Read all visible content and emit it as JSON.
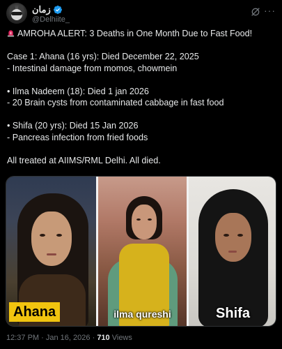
{
  "author": {
    "display_name": "زمان",
    "handle": "@Delhiite_",
    "verified": true
  },
  "post": {
    "lines": [
      "AMROHA ALERT: 3 Deaths in One Month Due to Fast Food!",
      "",
      "Case 1: Ahana (16 yrs): Died December 22, 2025",
      "- Intestinal damage from momos, chowmein",
      "",
      "• Ilma Nadeem (18): Died 1 jan 2026",
      "- 20 Brain cysts from contaminated cabbage in fast food",
      "",
      "• Shifa (20 yrs): Died 15 Jan 2026",
      "- Pancreas infection from fried foods",
      "",
      "All treated at AIIMS/RML Delhi. All died."
    ]
  },
  "media": {
    "panels": [
      {
        "label": "Ahana"
      },
      {
        "label": "ilma qureshi"
      },
      {
        "label": "Shifa"
      }
    ]
  },
  "footer": {
    "time": "12:37 PM",
    "date": "Jan 16, 2026",
    "views_count": "710",
    "views_label": "Views"
  },
  "colors": {
    "background": "#000000",
    "text": "#e7e9ea",
    "muted": "#71767b",
    "verified": "#1d9bf0",
    "label_yellow": "#f1c40f"
  }
}
